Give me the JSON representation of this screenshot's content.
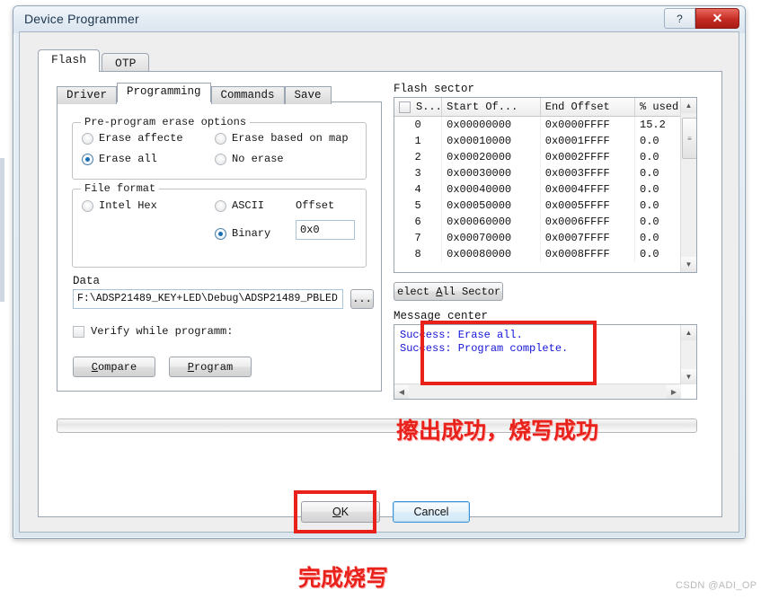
{
  "window": {
    "title": "Device Programmer",
    "help_button": "?",
    "close_button": "✕"
  },
  "outer_tabs": [
    {
      "label": "Flash",
      "active": true
    },
    {
      "label": "OTP",
      "active": false
    }
  ],
  "inner_tabs": [
    {
      "label": "Driver",
      "active": false
    },
    {
      "label": "Programming",
      "active": true
    },
    {
      "label": "Commands",
      "active": false
    },
    {
      "label": "Save",
      "active": false
    }
  ],
  "erase_group": {
    "legend": "Pre-program erase options",
    "options": [
      {
        "label": "Erase affecte",
        "selected": false
      },
      {
        "label": "Erase based on map",
        "selected": false
      },
      {
        "label": "Erase all",
        "selected": true
      },
      {
        "label": "No erase",
        "selected": false
      }
    ]
  },
  "format_group": {
    "legend": "File format",
    "options": [
      {
        "label": "Intel Hex",
        "selected": false
      },
      {
        "label": "ASCII",
        "selected": false
      },
      {
        "label": "Binary",
        "selected": true
      }
    ],
    "offset_label": "Offset",
    "offset_value": "0x0"
  },
  "data_section": {
    "label": "Data",
    "path_value": "F:\\ADSP21489_KEY+LED\\Debug\\ADSP21489_PBLED",
    "browse_label": "...",
    "verify_label": "Verify while programm:",
    "verify_checked": false,
    "compare_label": "Compare",
    "compare_accel": "C",
    "program_label": "Program",
    "program_accel": "P"
  },
  "flash_sector": {
    "label": "Flash sector",
    "columns": [
      "S...",
      "Start Of...",
      "End Offset",
      "% used"
    ],
    "rows": [
      {
        "index": "0",
        "start": "0x00000000",
        "end": "0x0000FFFF",
        "used": "15.2"
      },
      {
        "index": "1",
        "start": "0x00010000",
        "end": "0x0001FFFF",
        "used": "0.0"
      },
      {
        "index": "2",
        "start": "0x00020000",
        "end": "0x0002FFFF",
        "used": "0.0"
      },
      {
        "index": "3",
        "start": "0x00030000",
        "end": "0x0003FFFF",
        "used": "0.0"
      },
      {
        "index": "4",
        "start": "0x00040000",
        "end": "0x0004FFFF",
        "used": "0.0"
      },
      {
        "index": "5",
        "start": "0x00050000",
        "end": "0x0005FFFF",
        "used": "0.0"
      },
      {
        "index": "6",
        "start": "0x00060000",
        "end": "0x0006FFFF",
        "used": "0.0"
      },
      {
        "index": "7",
        "start": "0x00070000",
        "end": "0x0007FFFF",
        "used": "0.0"
      },
      {
        "index": "8",
        "start": "0x00080000",
        "end": "0x0008FFFF",
        "used": "0.0"
      }
    ],
    "select_all_label": "elect All Sector",
    "select_all_accel": "A"
  },
  "message_center": {
    "label": "Message center",
    "lines": [
      "Success: Erase all.",
      "Success: Program complete."
    ]
  },
  "dialog_buttons": {
    "ok": "OK",
    "ok_accel": "O",
    "cancel": "Cancel"
  },
  "annotations": {
    "success_note": "擦出成功，烧写成功",
    "finish_note": "完成烧写",
    "watermark": "CSDN @ADI_OP"
  }
}
